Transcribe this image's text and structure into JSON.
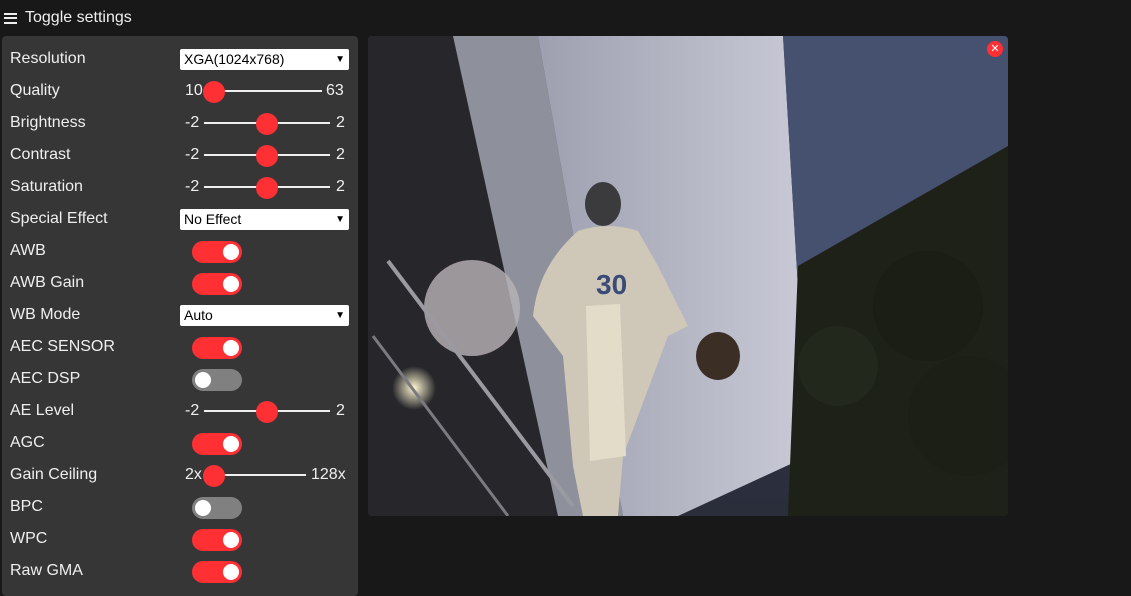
{
  "header": {
    "toggle_label": "Toggle settings"
  },
  "settings": {
    "resolution": {
      "label": "Resolution",
      "value": "XGA(1024x768)"
    },
    "quality": {
      "label": "Quality",
      "min": "10",
      "max": "63",
      "value": 10
    },
    "brightness": {
      "label": "Brightness",
      "min": "-2",
      "max": "2",
      "value": 0
    },
    "contrast": {
      "label": "Contrast",
      "min": "-2",
      "max": "2",
      "value": 0
    },
    "saturation": {
      "label": "Saturation",
      "min": "-2",
      "max": "2",
      "value": 0
    },
    "special_effect": {
      "label": "Special Effect",
      "value": "No Effect"
    },
    "awb": {
      "label": "AWB",
      "on": true
    },
    "awb_gain": {
      "label": "AWB Gain",
      "on": true
    },
    "wb_mode": {
      "label": "WB Mode",
      "value": "Auto"
    },
    "aec_sensor": {
      "label": "AEC SENSOR",
      "on": true
    },
    "aec_dsp": {
      "label": "AEC DSP",
      "on": false
    },
    "ae_level": {
      "label": "AE Level",
      "min": "-2",
      "max": "2",
      "value": 0
    },
    "agc": {
      "label": "AGC",
      "on": true
    },
    "gain_ceiling": {
      "label": "Gain Ceiling",
      "min": "2x",
      "max": "128x",
      "value": 0
    },
    "bpc": {
      "label": "BPC",
      "on": false
    },
    "wpc": {
      "label": "WPC",
      "on": true
    },
    "raw_gma": {
      "label": "Raw GMA",
      "on": true
    }
  },
  "stream": {
    "jersey_number": "30",
    "close_icon": "close-icon"
  },
  "colors": {
    "accent": "#ff3034",
    "panel": "#363636",
    "background": "#181818",
    "switch_off": "#808080"
  }
}
